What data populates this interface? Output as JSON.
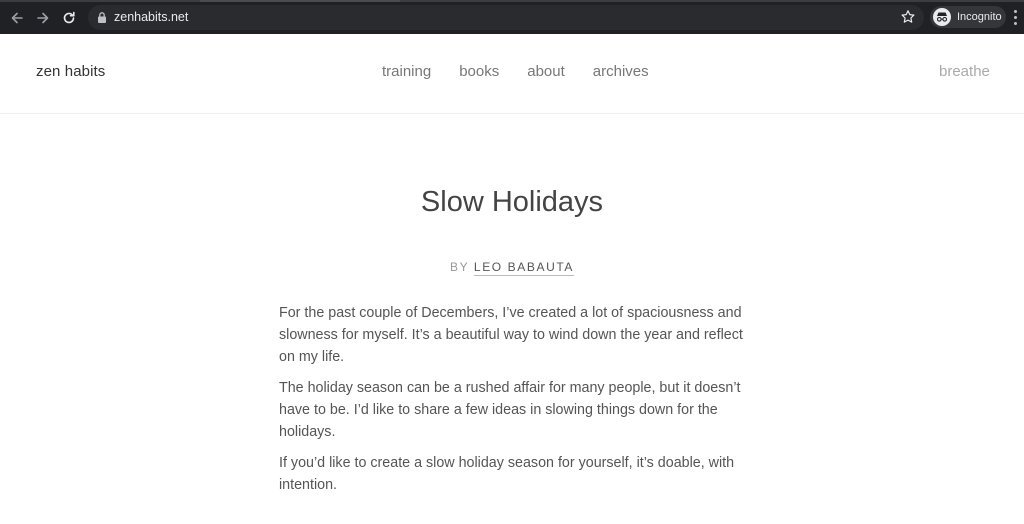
{
  "browser": {
    "url": "zenhabits.net",
    "profile_label": "Incognito"
  },
  "site": {
    "logo": "zen habits",
    "nav": [
      {
        "label": "training"
      },
      {
        "label": "books"
      },
      {
        "label": "about"
      },
      {
        "label": "archives"
      }
    ],
    "breathe_link": "breathe"
  },
  "post": {
    "title": "Slow Holidays",
    "by_label": "BY",
    "author": "LEO BABAUTA",
    "paragraphs": [
      "For the past couple of Decembers, I’ve created a lot of spaciousness and slowness for myself. It’s a beautiful way to wind down the year and reflect on my life.",
      "The holiday season can be a rushed affair for many people, but it doesn’t have to be. I’d like to share a few ideas in slowing things down for the holidays.",
      "If you’d like to create a slow holiday season for yourself, it’s doable, with intention."
    ]
  }
}
